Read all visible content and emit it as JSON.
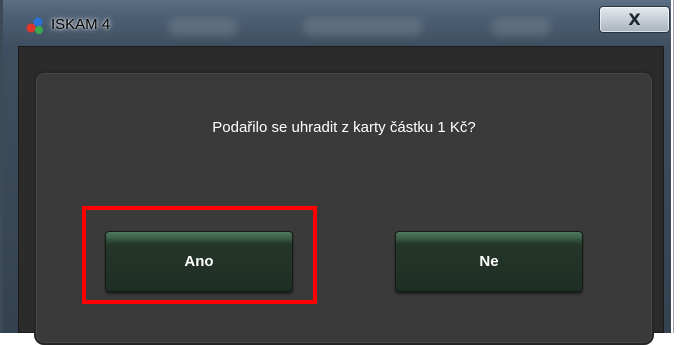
{
  "window": {
    "title": "ISKAM 4",
    "close_glyph": "X"
  },
  "dialog": {
    "message": "Podařilo se uhradit z karty částku 1 Kč?",
    "yes_label": "Ano",
    "no_label": "Ne"
  },
  "icons": {
    "app": "iskam-app-icon",
    "close": "close-icon"
  },
  "colors": {
    "highlight": "#ff0000",
    "button_text": "#ffffff",
    "panel": "#3a3a3a"
  }
}
